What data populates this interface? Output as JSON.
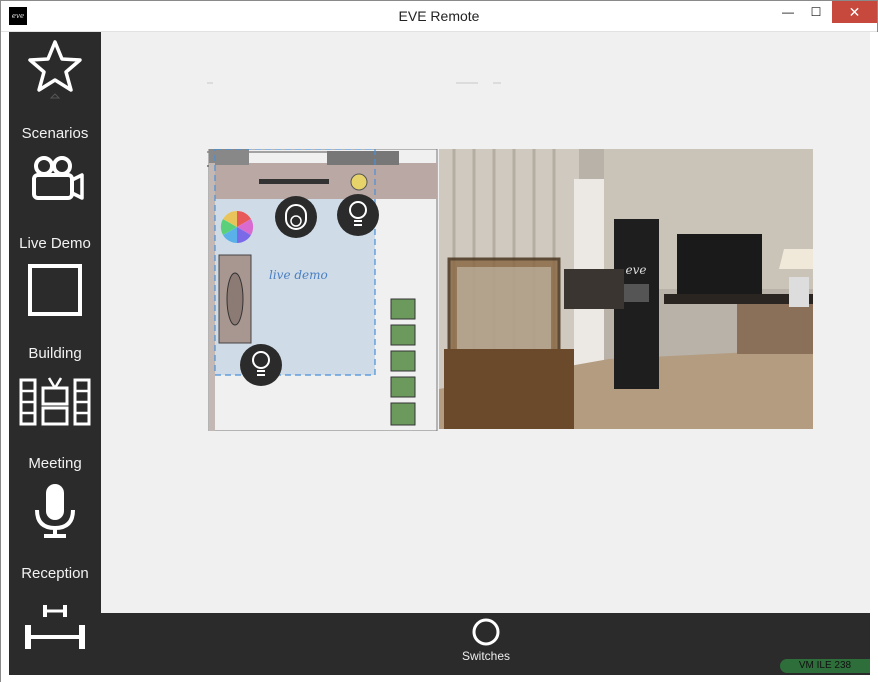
{
  "window": {
    "title": "EVE Remote",
    "app_icon_text": "eve",
    "buttons": {
      "minimize": "—",
      "maximize": "☐",
      "close": "✕"
    }
  },
  "sidebar": {
    "items": [
      {
        "label": "Scenarios",
        "icon": "star-icon"
      },
      {
        "label": "Live Demo",
        "icon": "video-camera-icon"
      },
      {
        "label": "Building",
        "icon": "square-icon"
      },
      {
        "label": "Meeting",
        "icon": "tv-shelf-icon"
      },
      {
        "label": "Reception",
        "icon": "microphone-icon"
      },
      {
        "label": "",
        "icon": "dumbbell-icon"
      }
    ]
  },
  "floorplan": {
    "room_label": "live demo",
    "devices": [
      {
        "name": "color-wheel",
        "icon": "color-wheel-icon"
      },
      {
        "name": "sensor",
        "icon": "sensor-icon"
      },
      {
        "name": "lamp-1",
        "icon": "bulb-icon"
      },
      {
        "name": "lamp-2",
        "icon": "bulb-icon"
      }
    ]
  },
  "bottombar": {
    "switches_label": "Switches",
    "vm_badge": "VM ILE 238"
  },
  "colors": {
    "sidebar_bg": "#2b2b2b",
    "content_bg": "#f0f0f0",
    "close_button": "#c7483c",
    "badge": "#2d6e3a"
  }
}
